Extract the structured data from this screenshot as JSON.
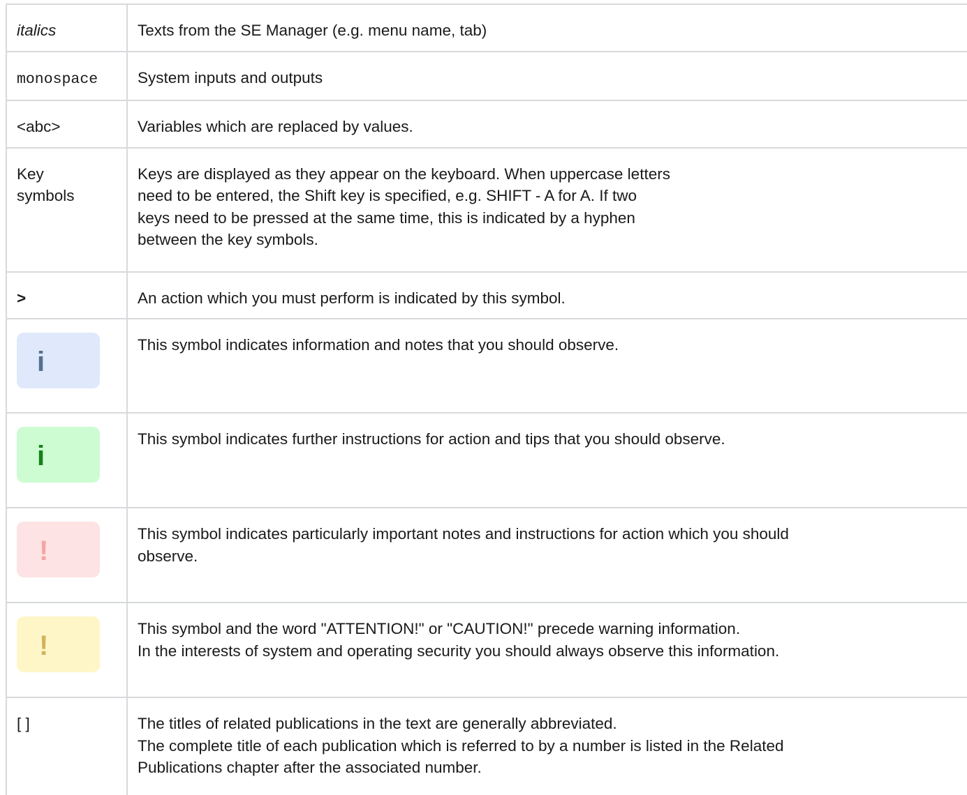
{
  "rows": [
    {
      "symbol": "italics",
      "desc": [
        "Texts from the SE Manager (e.g. menu name, tab)"
      ]
    },
    {
      "symbol": "monospace",
      "desc": [
        "System inputs and outputs"
      ]
    },
    {
      "symbol": "<abc>",
      "desc": [
        "Variables which are replaced by values."
      ]
    },
    {
      "symbol": [
        "Key",
        "symbols"
      ],
      "desc": [
        "Keys are displayed as they appear on the keyboard. When uppercase letters",
        "need to be entered, the Shift key is specified, e.g. SHIFT - A for A. If two",
        "keys need to be pressed at the same time, this is indicated by a hyphen",
        "between the key symbols."
      ]
    },
    {
      "symbol": ">",
      "desc": [
        "An action which you must perform is indicated by this symbol."
      ]
    },
    {
      "symbol": "i",
      "icon": "info-icon",
      "bg": "#dfe9fb",
      "fg": "#56708f",
      "desc": [
        "This symbol indicates information and notes that you should observe."
      ]
    },
    {
      "symbol": "i",
      "icon": "tip-icon",
      "bg": "#cdfcd3",
      "fg": "#14821b",
      "desc": [
        "This symbol indicates further instructions for action and tips that you should observe."
      ]
    },
    {
      "symbol": "!",
      "icon": "important-icon",
      "bg": "#fde3e3",
      "fg": "#f6a3a3",
      "desc": [
        "This symbol indicates particularly important notes and instructions for action which you should",
        "observe."
      ]
    },
    {
      "symbol": "!",
      "icon": "warning-icon",
      "bg": "#fef6c7",
      "fg": "#d1b35c",
      "desc": [
        "This symbol and the word \"ATTENTION!\" or \"CAUTION!\" precede warning information.",
        "In the interests of system and operating security you should always observe this information."
      ]
    },
    {
      "symbol": "[ ]",
      "desc": [
        "The titles of related publications in the text are generally abbreviated.",
        "The complete title of each publication which is referred to by a number is listed in the Related",
        "Publications chapter after the associated number."
      ]
    }
  ]
}
